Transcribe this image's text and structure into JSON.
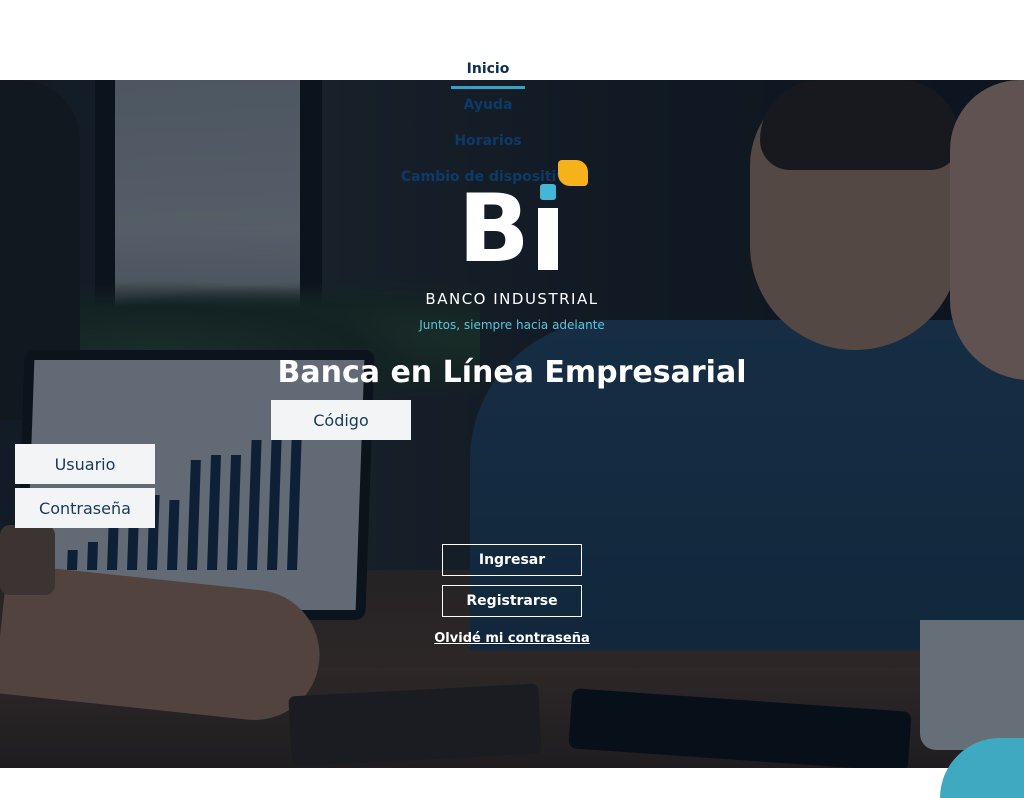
{
  "nav": {
    "items": [
      {
        "label": "Inicio",
        "active": true
      },
      {
        "label": "Ayuda",
        "active": false
      },
      {
        "label": "Horarios",
        "active": false
      },
      {
        "label": "Cambio de dispositivo",
        "active": false
      }
    ]
  },
  "brand": {
    "name": "BANCO INDUSTRIAL",
    "tagline": "Juntos, siempre hacia adelante",
    "colors": {
      "accent_blue": "#34a4c4",
      "accent_yellow": "#f6b21b",
      "nav_text": "#0d3a66"
    }
  },
  "login": {
    "title": "Banca en Línea Empresarial",
    "codigo_placeholder": "Código",
    "usuario_placeholder": "Usuario",
    "contrasena_placeholder": "Contraseña",
    "ingresar_label": "Ingresar",
    "registrarse_label": "Registrarse",
    "forgot_label": "Olvidé mi contraseña"
  }
}
